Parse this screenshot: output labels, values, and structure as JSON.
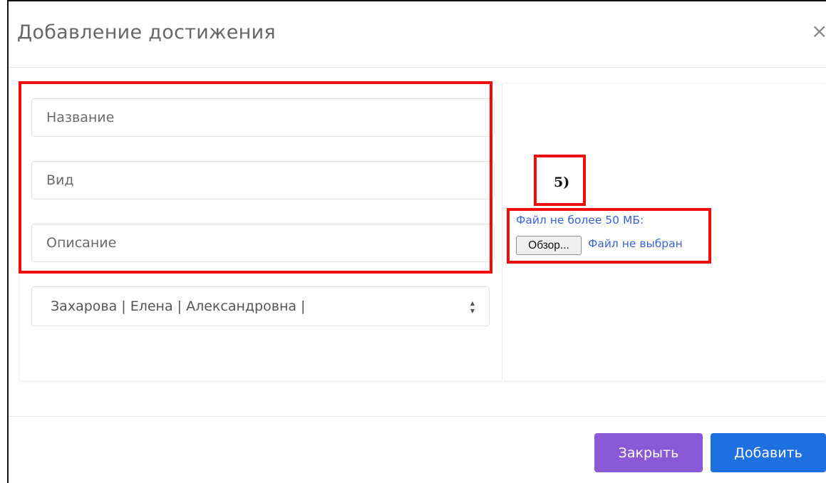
{
  "modal": {
    "title": "Добавление достижения",
    "close_glyph": "×"
  },
  "form": {
    "name_placeholder": "Название",
    "type_placeholder": "Вид",
    "description_placeholder": "Описание",
    "person_select": {
      "selected": "Захарова | Елена | Александровна |",
      "arrow_up": "▲",
      "arrow_down": "▼"
    }
  },
  "upload": {
    "hint": "Файл не более 50 МБ:",
    "browse_label": "Обзор...",
    "no_file_label": "Файл не выбран"
  },
  "annotation": {
    "label": "5)",
    "color": "#f00d0d"
  },
  "footer": {
    "close_label": "Закрыть",
    "add_label": "Добавить",
    "close_color": "#8a5ad6",
    "add_color": "#1e6fe0"
  },
  "icons": {
    "close": "close-icon",
    "select_arrow": "sort-arrows-icon"
  }
}
